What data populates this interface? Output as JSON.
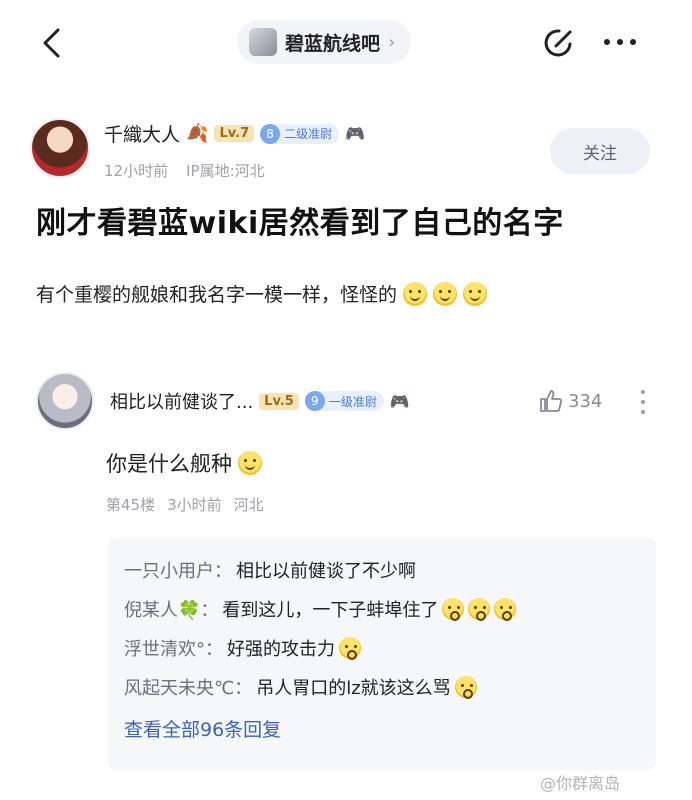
{
  "nav": {
    "forum_name": "碧蓝航线吧",
    "chevron": "›"
  },
  "post": {
    "author": "千織大人",
    "level": "Lv.7",
    "rank_num": "8",
    "rank_title": "二级准尉",
    "time": "12小时前",
    "ip": "IP属地:河北",
    "follow_label": "关注",
    "title": "刚才看碧蓝wiki居然看到了自己的名字",
    "body": "有个重樱的舰娘和我名字一模一样，怪怪的"
  },
  "comment": {
    "author": "相比以前健谈了...",
    "level": "Lv.5",
    "rank_num": "9",
    "rank_title": "一级准尉",
    "likes": "334",
    "body": "你是什么舰种",
    "floor": "第45楼",
    "time": "3小时前",
    "location": "河北"
  },
  "replies": [
    {
      "user": "一只小用户：",
      "text": "相比以前健谈了不少啊",
      "emojis": 0
    },
    {
      "user": "倪某人🍀：",
      "text": "看到这儿，一下子蚌埠住了",
      "emojis": 3
    },
    {
      "user": "浮世清欢°：",
      "text": "好强的攻击力",
      "emojis": 1
    },
    {
      "user": "风起天未央℃：",
      "text": "吊人胃口的lz就该这么骂",
      "emojis": 1
    }
  ],
  "view_all": "查看全部96条回复",
  "watermark": "@你群离岛",
  "colors": {
    "accent_link": "#3c63b8",
    "rank_blue": "#7ba7ec",
    "level_gold": "#a26b10"
  }
}
